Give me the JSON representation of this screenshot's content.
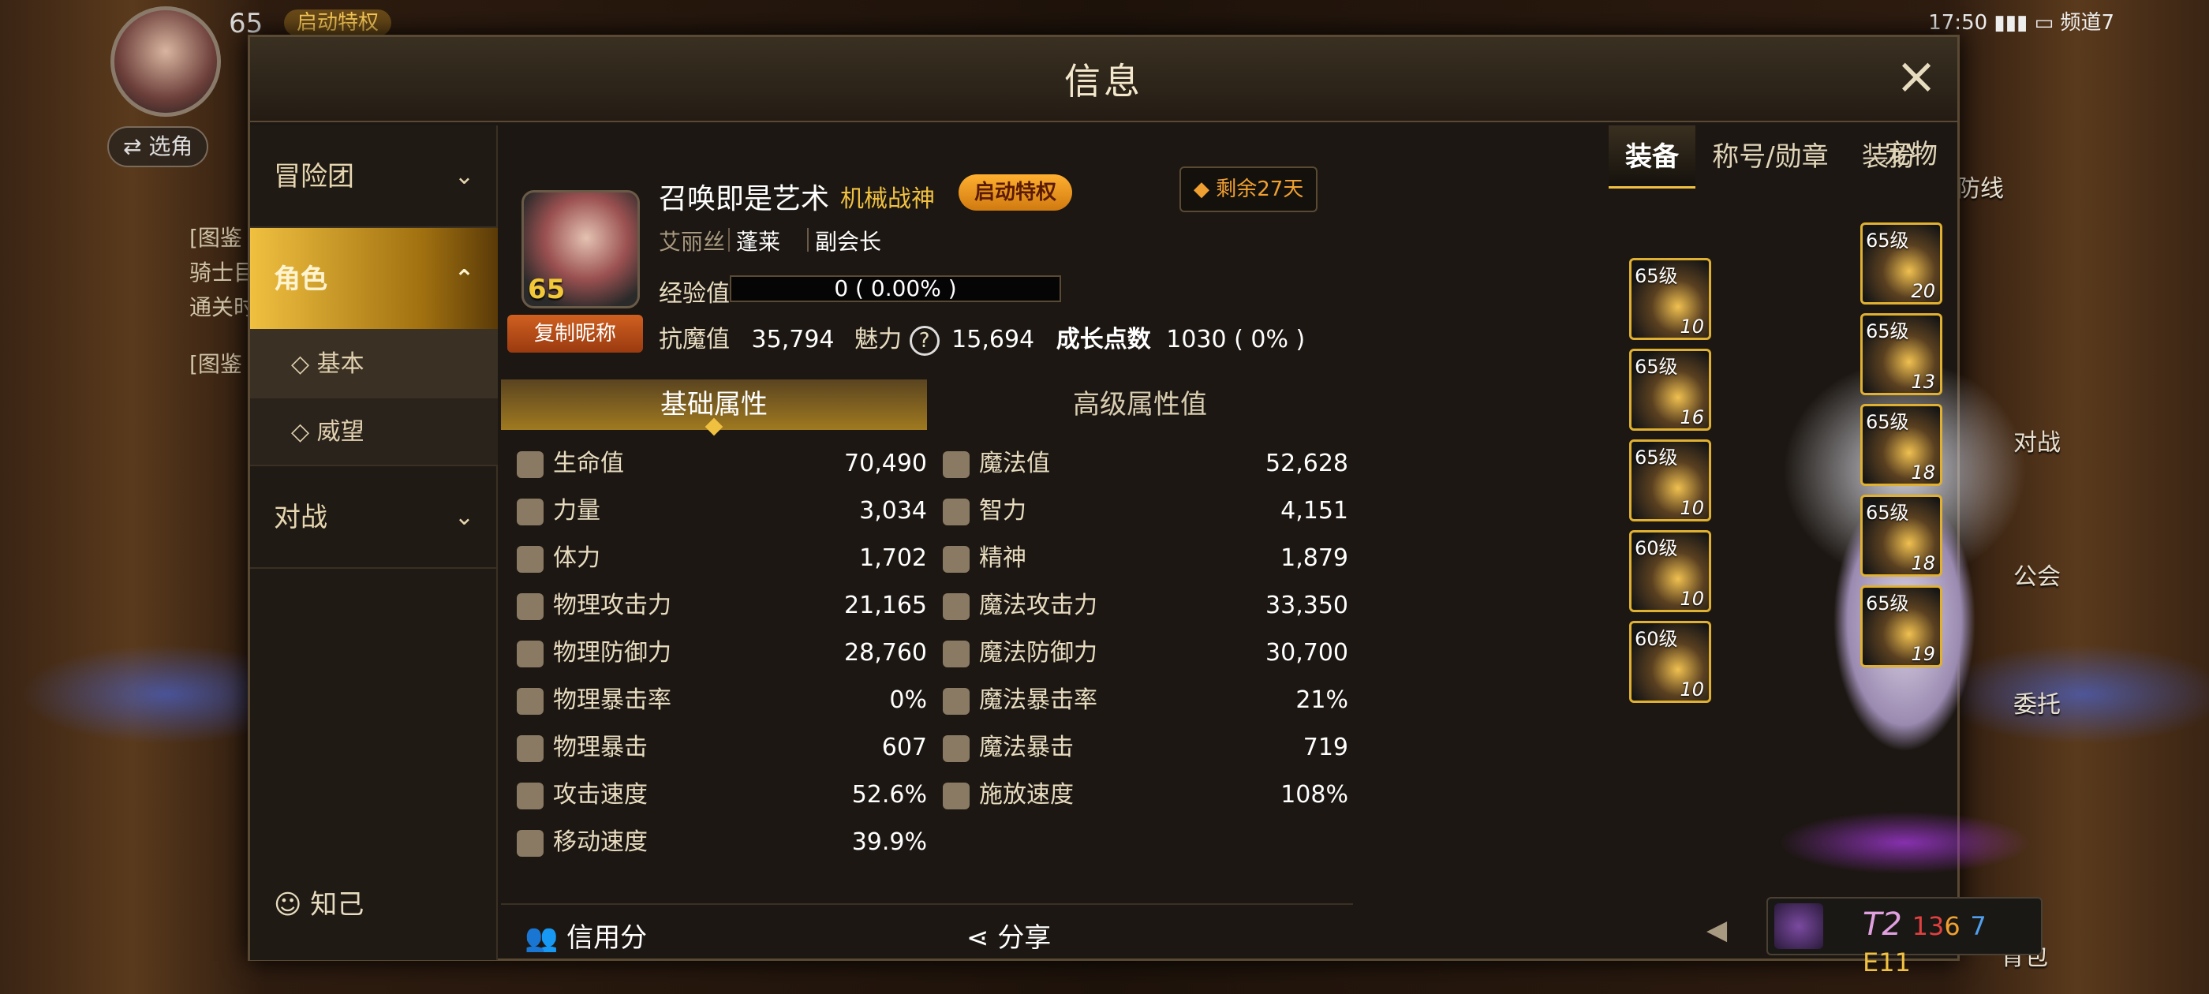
{
  "status": {
    "time": "17:50",
    "channel": "频道7"
  },
  "topleft": {
    "level": "65",
    "badge": "启动特权",
    "select_role": "⇄ 选角"
  },
  "bg_side": {
    "left": [
      "[图鉴",
      "骑士目",
      "通关时",
      "[图鉴"
    ],
    "right": [
      "对战",
      "公会",
      "委托",
      "背包",
      "防线"
    ]
  },
  "window": {
    "title": "信息",
    "close": "×"
  },
  "nav": {
    "items": [
      "冒险团",
      "角色",
      "对战"
    ],
    "sub": [
      "基本",
      "威望"
    ],
    "footer": "知己"
  },
  "profile": {
    "level": "65",
    "copy": "复制昵称",
    "name": "召唤即是艺术",
    "job": "机械战神",
    "privilege": "启动特权",
    "remaining": "剩余27天",
    "server": "艾丽丝",
    "guild": "蓬莱",
    "rank": "副会长",
    "exp_label": "经验值",
    "exp_value": "0 ( 0.00% )",
    "anti_label": "抗魔值",
    "anti_value": "35,794",
    "charm_label": "魅力",
    "charm_value": "15,694",
    "growth_label": "成长点数",
    "growth_value": "1030 ( 0% )"
  },
  "tabs": [
    "基础属性",
    "高级属性值"
  ],
  "stats": [
    {
      "l": "生命值",
      "lv": "70,490",
      "r": "魔法值",
      "rv": "52,628"
    },
    {
      "l": "力量",
      "lv": "3,034",
      "r": "智力",
      "rv": "4,151"
    },
    {
      "l": "体力",
      "lv": "1,702",
      "r": "精神",
      "rv": "1,879"
    },
    {
      "l": "物理攻击力",
      "lv": "21,165",
      "r": "魔法攻击力",
      "rv": "33,350"
    },
    {
      "l": "物理防御力",
      "lv": "28,760",
      "r": "魔法防御力",
      "rv": "30,700"
    },
    {
      "l": "物理暴击率",
      "lv": "0%",
      "r": "魔法暴击率",
      "rv": "21%"
    },
    {
      "l": "物理暴击",
      "lv": "607",
      "r": "魔法暴击",
      "rv": "719"
    },
    {
      "l": "攻击速度",
      "lv": "52.6%",
      "r": "施放速度",
      "rv": "108%"
    },
    {
      "l": "移动速度",
      "lv": "39.9%",
      "r": "",
      "rv": ""
    }
  ],
  "bottom": {
    "credit": "信用分",
    "share": "分享"
  },
  "right_tabs": [
    "装备",
    "称号/勋章",
    "装扮",
    "宠物"
  ],
  "equip_left": [
    {
      "lv": "65级",
      "n": "10"
    },
    {
      "lv": "65级",
      "n": "16"
    },
    {
      "lv": "65级",
      "n": "10"
    },
    {
      "lv": "60级",
      "n": "10"
    },
    {
      "lv": "60级",
      "n": "10"
    }
  ],
  "equip_right": [
    {
      "lv": "65级",
      "n": "20"
    },
    {
      "lv": "65级",
      "n": "13"
    },
    {
      "lv": "65级",
      "n": "18"
    },
    {
      "lv": "65级",
      "n": "18"
    },
    {
      "lv": "65级",
      "n": "19"
    }
  ],
  "rank_bar": {
    "t": "T2",
    "a": "13",
    "b": "6",
    "c": "7",
    "e": "E11"
  }
}
